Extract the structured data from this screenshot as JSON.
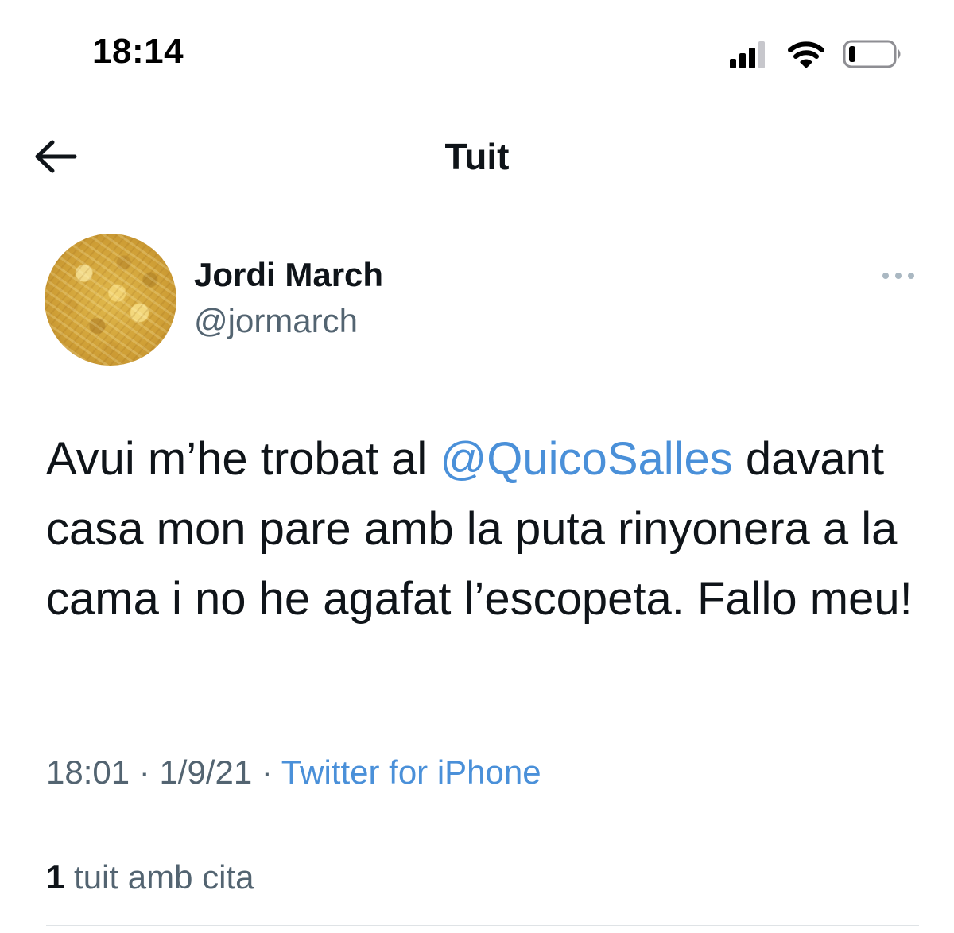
{
  "status_bar": {
    "time": "18:14",
    "icons": [
      "cellular-signal-icon",
      "wifi-icon",
      "battery-icon"
    ]
  },
  "header": {
    "back_icon": "arrow-left-icon",
    "title": "Tuit"
  },
  "tweet": {
    "author": {
      "name": "Jordi March",
      "handle": "@jormarch"
    },
    "more_icon": "more-dots-icon",
    "text_before_mention": "Avui m’he trobat al ",
    "mention": "@QuicoSalles",
    "text_after_mention": " davant casa mon pare amb la puta rinyonera a la cama i no he agafat l’escopeta. Fallo meu!",
    "time": "18:01",
    "separator": " · ",
    "date": "1/9/21",
    "source": "Twitter for iPhone"
  },
  "stats": {
    "quote_count": "1",
    "quote_label": " tuit amb cita"
  },
  "colors": {
    "text": "#0f1419",
    "secondary_text": "#536471",
    "link": "#4a90d9",
    "divider": "#dfe3e6"
  }
}
